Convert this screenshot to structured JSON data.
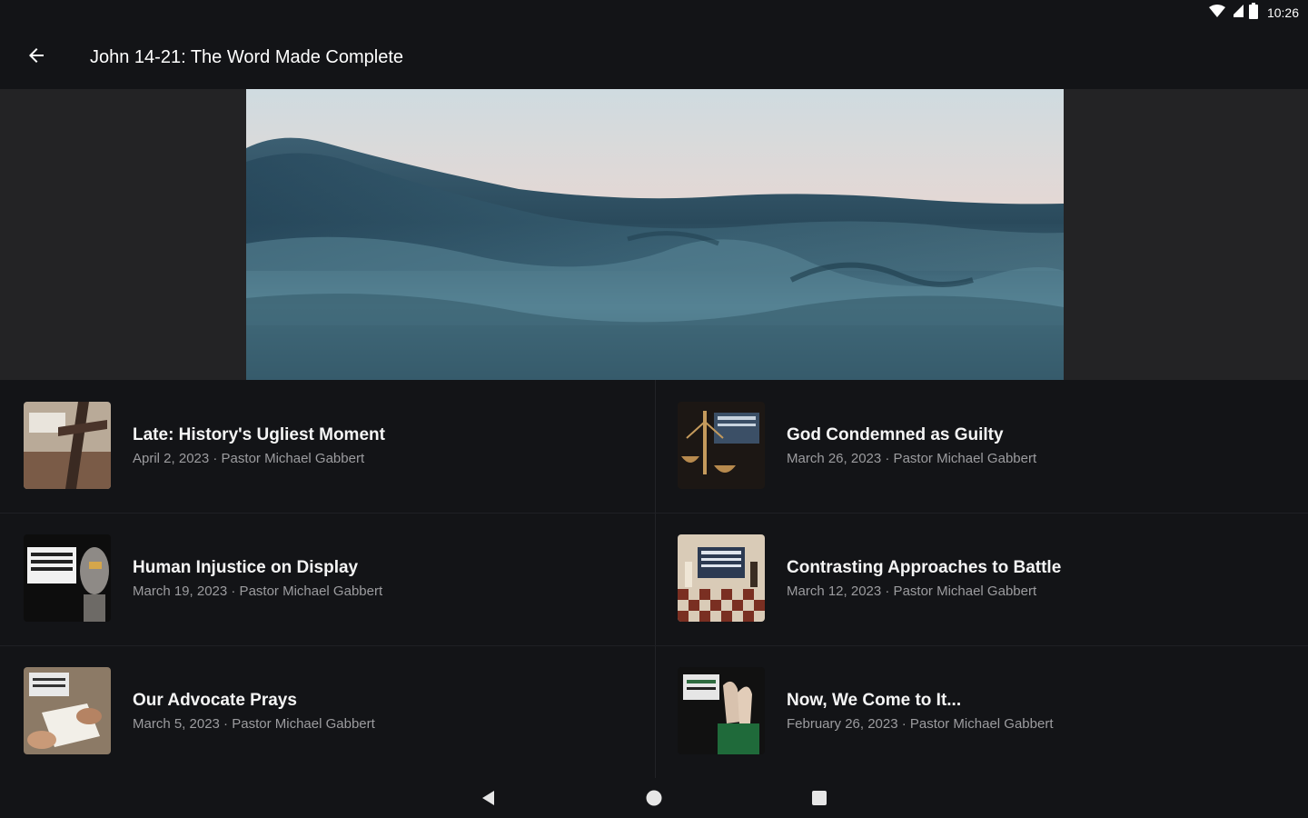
{
  "status_bar": {
    "time": "10:26",
    "icons": [
      "wifi-icon",
      "signal-icon",
      "battery-icon"
    ]
  },
  "app_bar": {
    "back_icon": "arrow-back-icon",
    "title": "John 14-21: The Word Made Complete"
  },
  "hero": {
    "image_description_icon": "ocean-wave-image"
  },
  "sermons": [
    {
      "title": "Late: History's Ugliest Moment",
      "subtitle": "April 2, 2023 · Pastor Michael Gabbert",
      "thumb": "cross-thumbnail"
    },
    {
      "title": "God Condemned as Guilty",
      "subtitle": "March 26, 2023 · Pastor Michael Gabbert",
      "thumb": "scales-thumbnail"
    },
    {
      "title": "Human Injustice on Display",
      "subtitle": "March 19, 2023 · Pastor Michael Gabbert",
      "thumb": "statue-thumbnail"
    },
    {
      "title": "Contrasting Approaches to Battle",
      "subtitle": "March 12, 2023 · Pastor Michael Gabbert",
      "thumb": "chess-thumbnail"
    },
    {
      "title": "Our Advocate Prays",
      "subtitle": "March 5, 2023 · Pastor Michael Gabbert",
      "thumb": "hands-thumbnail"
    },
    {
      "title": "Now, We Come to It...",
      "subtitle": "February 26, 2023 · Pastor Michael Gabbert",
      "thumb": "raised-hands-thumbnail"
    }
  ],
  "nav_bar": {
    "buttons": [
      "back-triangle-icon",
      "home-circle-icon",
      "recents-square-icon"
    ]
  },
  "colors": {
    "background": "#131417",
    "hero_band": "#232325",
    "subtitle": "#9c9c9f"
  }
}
